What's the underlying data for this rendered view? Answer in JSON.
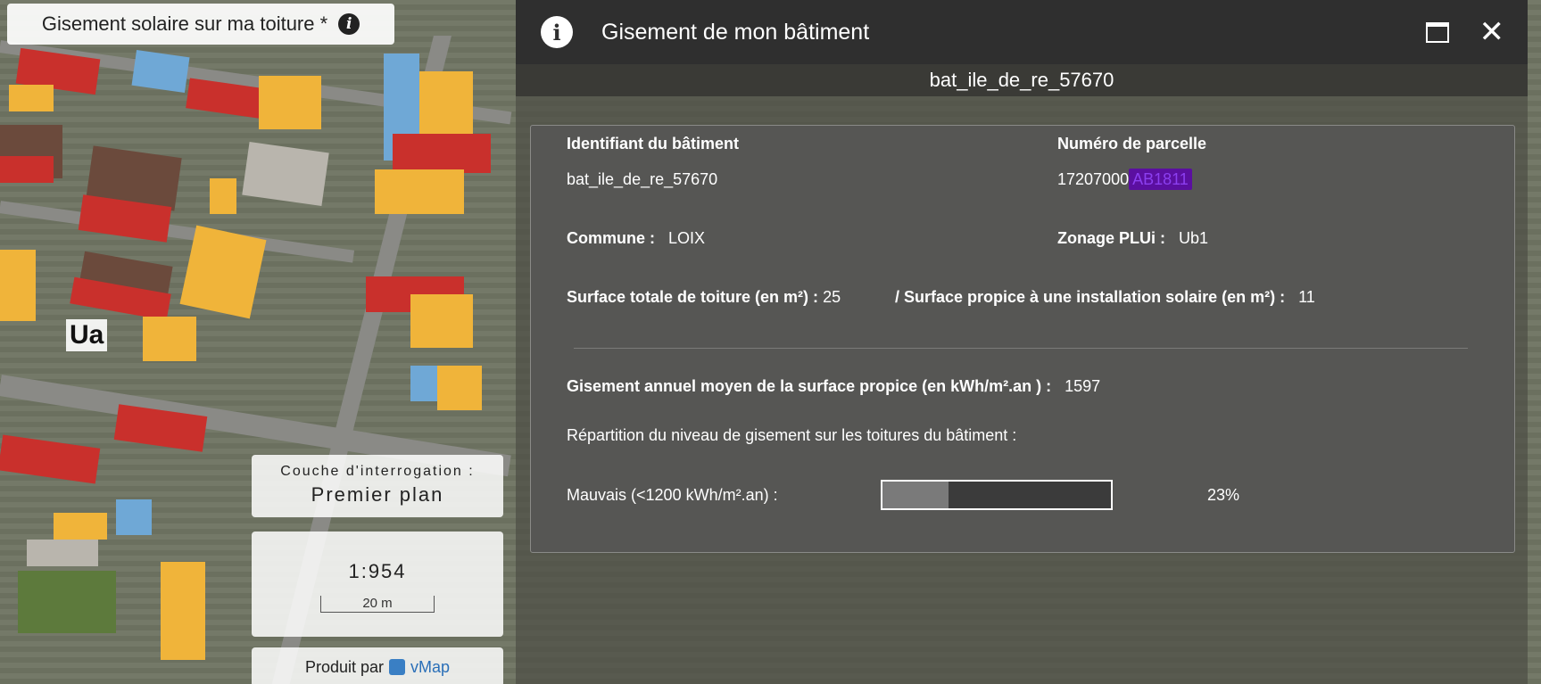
{
  "map": {
    "title": "Gisement solaire sur ma toiture *",
    "zone_label": "Ua",
    "query_widget": {
      "label": "Couche d'interrogation :",
      "value": "Premier plan"
    },
    "scale_widget": {
      "ratio": "1:954",
      "bar_label": "20 m"
    },
    "produced_by": {
      "prefix": "Produit par",
      "brand": "vMap"
    }
  },
  "panel": {
    "title": "Gisement de mon bâtiment",
    "subtitle": "bat_ile_de_re_57670",
    "fields": {
      "building_id_label": "Identifiant du bâtiment",
      "building_id_value": "bat_ile_de_re_57670",
      "parcel_label": "Numéro de parcelle",
      "parcel_prefix": "17207000",
      "parcel_highlight": "AB1811",
      "commune_label": "Commune :",
      "commune_value": "LOIX",
      "zoning_label": "Zonage PLUi :",
      "zoning_value": "Ub1",
      "roof_total_label": "Surface totale de toiture (en m²) :",
      "roof_total_value": "25",
      "roof_suitable_label": "/ Surface propice à une installation solaire (en m²) :",
      "roof_suitable_value": "11",
      "annual_label": "Gisement annuel moyen de la surface propice (en kWh/m².an ) :",
      "annual_value": "1597",
      "distribution_label": "Répartition du niveau de gisement sur les toitures du bâtiment :",
      "bad_label": "Mauvais (<1200 kWh/m².an) :",
      "bad_percent": "23%",
      "bad_fraction": 0.29
    }
  },
  "colors": {
    "header_bg": "#2f2f2f",
    "card_bg": "#565654",
    "parcel_highlight_bg": "#5b0fa0",
    "roof_red": "#c9302c",
    "roof_yellow": "#f0b43a",
    "roof_blue": "#6fa8d6"
  },
  "icons": {
    "map_info": "info-icon",
    "panel_info": "info-icon",
    "maximize": "maximize-icon",
    "close": "close-icon",
    "brand": "vmap-logo-icon"
  }
}
